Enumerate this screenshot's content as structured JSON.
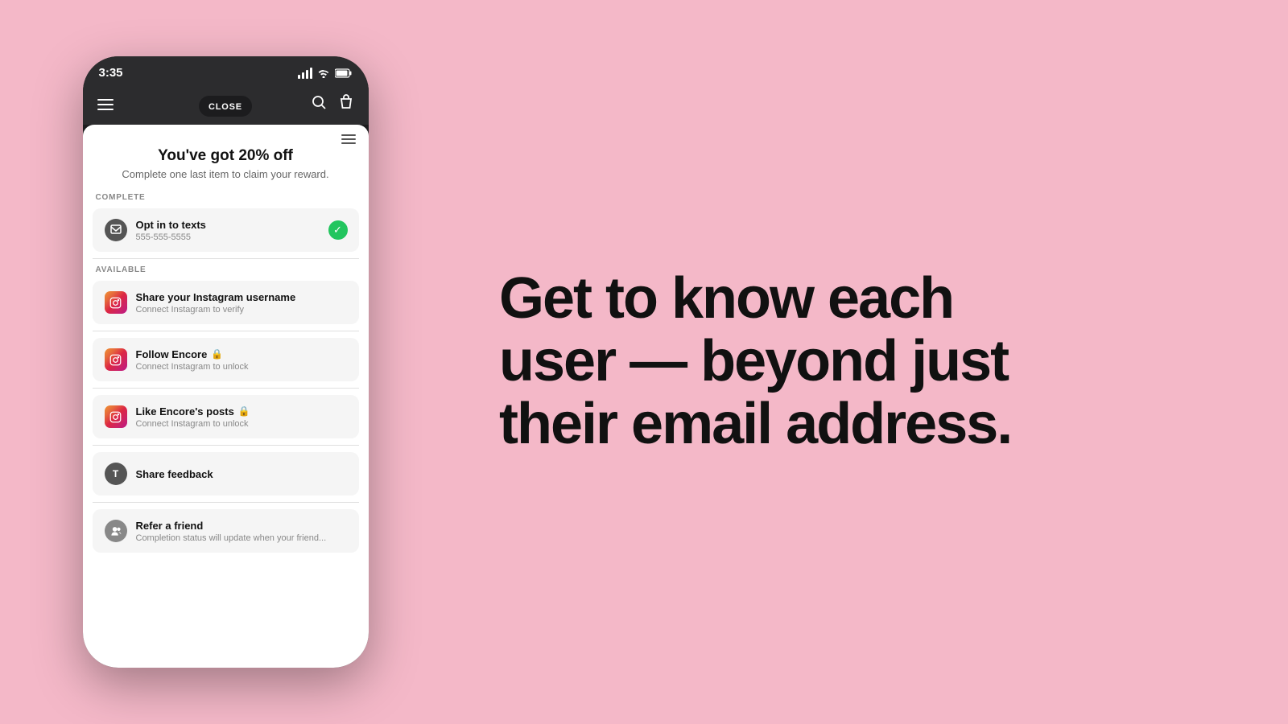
{
  "background_color": "#f4b8c8",
  "phone": {
    "status_bar": {
      "time": "3:35"
    },
    "navbar": {
      "close_label": "CLOSE"
    },
    "reward": {
      "title": "You've got 20% off",
      "subtitle": "Complete one last item to claim your reward."
    },
    "sections": {
      "complete_label": "COMPLETE",
      "available_label": "AVAILABLE"
    },
    "tasks": {
      "completed": {
        "title": "Opt in to texts",
        "phone_number": "555-555-5555"
      },
      "instagram_share": {
        "title": "Share your Instagram username",
        "subtitle": "Connect Instagram to verify"
      },
      "follow_encore": {
        "title": "Follow Encore",
        "subtitle": "Connect Instagram to unlock"
      },
      "like_posts": {
        "title": "Like Encore's posts",
        "subtitle": "Connect Instagram to unlock"
      },
      "feedback": {
        "title": "Share feedback"
      },
      "refer": {
        "title": "Refer a friend",
        "subtitle": "Completion status will update when your friend..."
      }
    }
  },
  "headline": {
    "line1": "Get to know each",
    "line2": "user — beyond just",
    "line3": "their email address."
  },
  "icons": {
    "instagram": "📷",
    "lock": "🔒",
    "check": "✓",
    "hamburger": "☰",
    "search": "🔍",
    "bag": "🛍",
    "close": "✕",
    "t_avatar": "T"
  }
}
